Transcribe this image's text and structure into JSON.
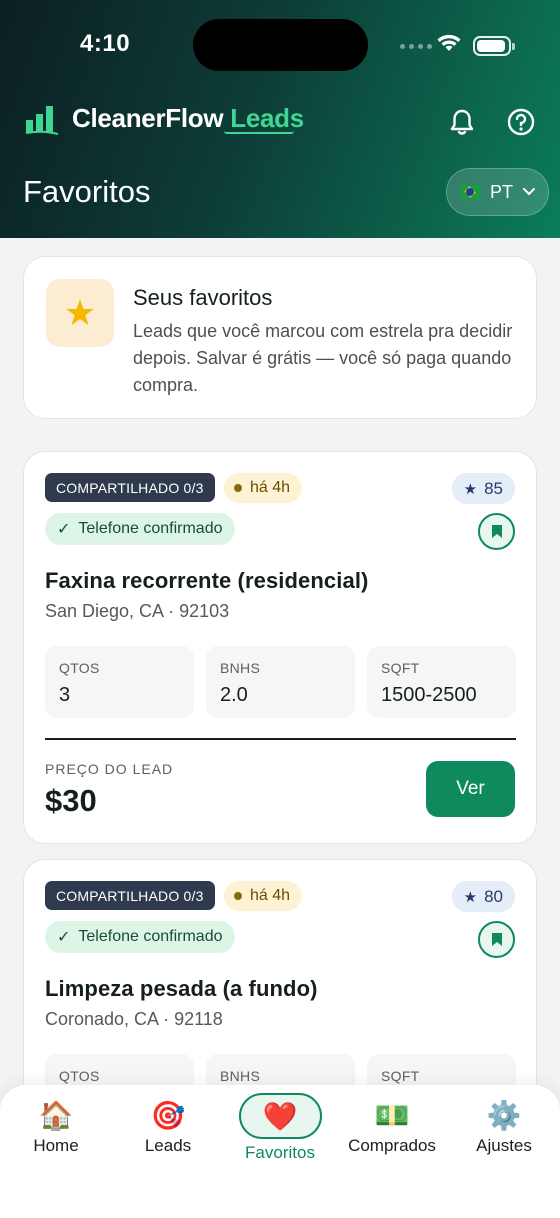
{
  "status_bar": {
    "time": "4:10"
  },
  "brand": {
    "name_main": "CleanerFlow",
    "name_accent": "Leads",
    "accent_color": "#3fd694"
  },
  "header": {
    "title": "Favoritos",
    "language": "PT"
  },
  "info_card": {
    "title": "Seus favoritos",
    "text": "Leads que você marcou com estrela pra decidir depois. Salvar é grátis — você só paga quando compra."
  },
  "leads": [
    {
      "shared": "COMPARTILHADO 0/3",
      "age": "há 4h",
      "score": "85",
      "phone": "Telefone confirmado",
      "title": "Faxina recorrente (residencial)",
      "location": "San Diego, CA · 92103",
      "stats": [
        {
          "label": "QTOS",
          "value": "3"
        },
        {
          "label": "BNHS",
          "value": "2.0"
        },
        {
          "label": "SQFT",
          "value": "1500-2500"
        }
      ],
      "price_label": "PREÇO DO LEAD",
      "price": "$30",
      "action": "Ver"
    },
    {
      "shared": "COMPARTILHADO 0/3",
      "age": "há 4h",
      "score": "80",
      "phone": "Telefone confirmado",
      "title": "Limpeza pesada (a fundo)",
      "location": "Coronado, CA · 92118",
      "stats": [
        {
          "label": "QTOS",
          "value": ""
        },
        {
          "label": "BNHS",
          "value": ""
        },
        {
          "label": "SQFT",
          "value": ""
        }
      ]
    }
  ],
  "nav": {
    "active": "Favoritos",
    "items": [
      {
        "label": "Home",
        "icon": "house-icon"
      },
      {
        "label": "Leads",
        "icon": "target-icon"
      },
      {
        "label": "Favoritos",
        "icon": "heart-icon"
      },
      {
        "label": "Comprados",
        "icon": "money-icon"
      },
      {
        "label": "Ajustes",
        "icon": "gear-icon"
      }
    ]
  },
  "colors": {
    "primary": "#0e8a5c",
    "header_dark": "#0c1f22",
    "badge_dark": "#2f3a4f"
  }
}
